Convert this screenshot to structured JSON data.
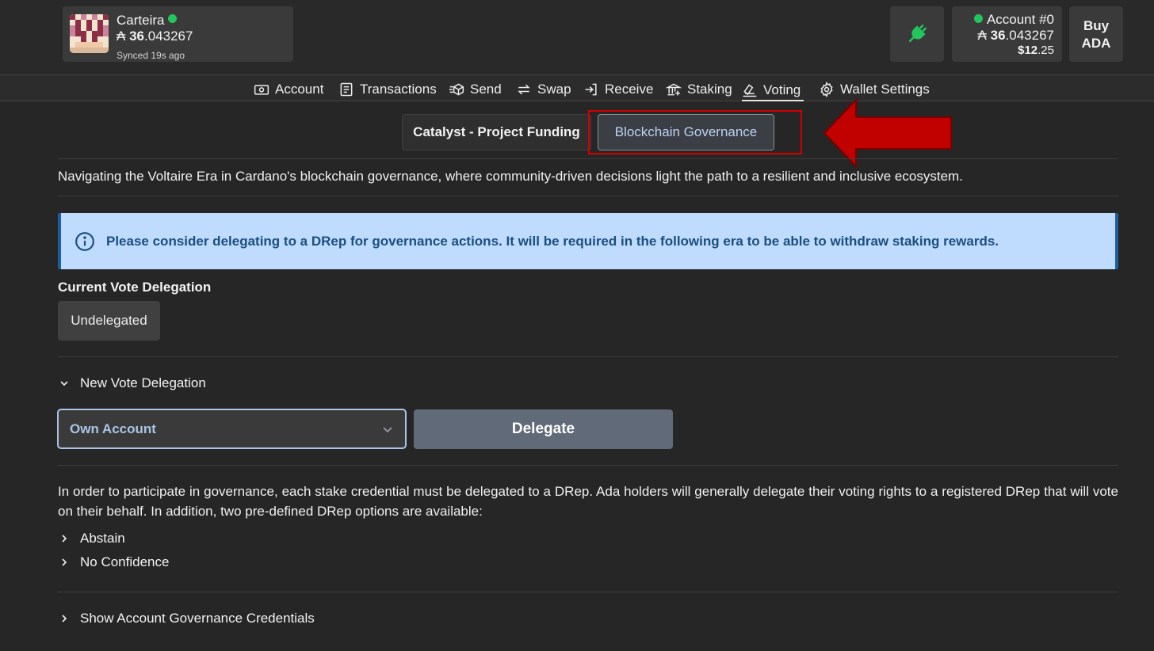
{
  "header": {
    "wallet": {
      "name": "Carteira",
      "balance_symbol": "₳",
      "balance_int": "36",
      "balance_dec": ".043267",
      "sync_status": "Synced 19s ago"
    },
    "account": {
      "name": "Account #0",
      "balance_symbol": "₳",
      "balance_int": "36",
      "balance_dec": ".043267",
      "usd_int": "$12",
      "usd_dec": ".25"
    },
    "buy_label_line1": "Buy",
    "buy_label_line2": "ADA",
    "status_color": "#22c55e"
  },
  "nav": {
    "items": [
      {
        "label": "Account",
        "icon": "cash-icon"
      },
      {
        "label": "Transactions",
        "icon": "document-list-icon"
      },
      {
        "label": "Send",
        "icon": "send-cube-icon"
      },
      {
        "label": "Swap",
        "icon": "swap-arrows-icon"
      },
      {
        "label": "Receive",
        "icon": "receive-icon"
      },
      {
        "label": "Staking",
        "icon": "bank-icon"
      },
      {
        "label": "Voting",
        "icon": "ballot-icon"
      },
      {
        "label": "Wallet Settings",
        "icon": "gear-icon"
      }
    ],
    "active": "Voting"
  },
  "tabs": {
    "catalyst": "Catalyst - Project Funding",
    "governance": "Blockchain Governance"
  },
  "intro": "Navigating the Voltaire Era in Cardano's blockchain governance, where community-driven decisions light the path to a resilient and inclusive ecosystem.",
  "info_banner": "Please consider delegating to a DRep for governance actions. It will be required in the following era to be able to withdraw staking rewards.",
  "current_delegation": {
    "label": "Current Vote Delegation",
    "value": "Undelegated"
  },
  "new_delegation": {
    "label": "New Vote Delegation",
    "select_value": "Own Account",
    "delegate_button": "Delegate"
  },
  "explanation": "In order to participate in governance, each stake credential must be delegated to a DRep. Ada holders will generally delegate their voting rights to a registered DRep that will vote on their behalf. In addition, two pre-defined DRep options are available:",
  "options": [
    "Abstain",
    "No Confidence"
  ],
  "credentials_toggle": "Show Account Governance Credentials",
  "colors": {
    "highlight": "#d40000",
    "info_bg": "#bfdbfe",
    "info_text": "#1b4f7e"
  }
}
